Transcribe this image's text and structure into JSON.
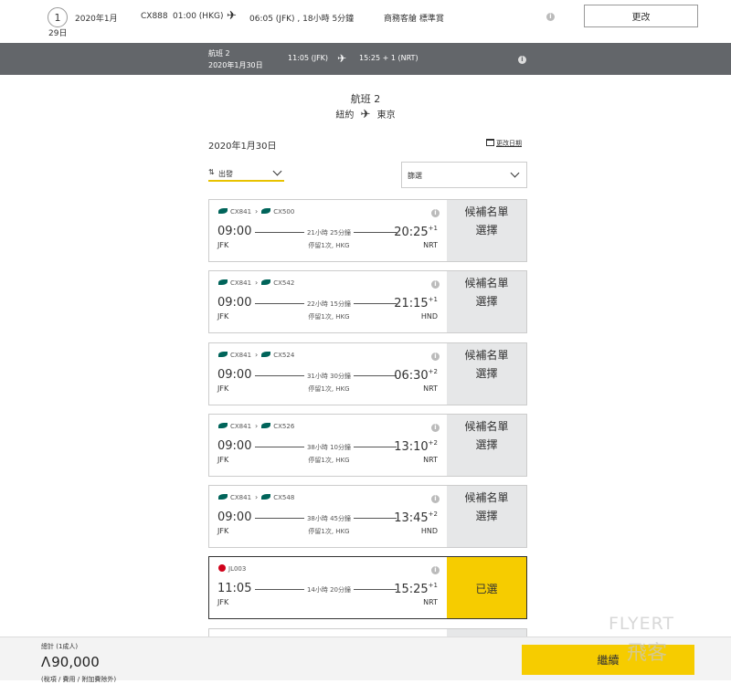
{
  "top_summary": {
    "step": "1",
    "date_line1": "2020年1月",
    "date_line2": "29日",
    "flight": "CX888",
    "depart": "01:00 (HKG)",
    "plane_glyph": "✈",
    "arrive_duration": "06:05 (JFK) , 18小時 5分鐘",
    "cabin": "商務客艙 標準賞",
    "info_icon": "i",
    "change_label": "更改"
  },
  "segment_bar": {
    "title": "航班 2",
    "date": "2020年1月30日",
    "depart_time": "11:05 (JFK)",
    "plane_glyph": "✈",
    "arrive_time": "15:25 + 1 (NRT)",
    "info_icon": "i"
  },
  "heading": {
    "title": "航班 2",
    "from": "紐約",
    "plane_glyph": "✈",
    "to": "東京"
  },
  "date_section": {
    "date": "2020年1月30日",
    "change_date": "更改日期"
  },
  "sort": {
    "icon": "⇅",
    "value": "出發"
  },
  "filter": {
    "value": "篩選"
  },
  "flights": [
    {
      "codes": [
        "CX841",
        "CX500"
      ],
      "dep_time": "09:00",
      "dep_airport": "JFK",
      "duration": "21小時 25分鐘",
      "stops": "停留1次, HKG",
      "arr_time": "20:25",
      "arr_offset": "+1",
      "arr_airport": "NRT",
      "status": "候補名單",
      "action": "選擇",
      "selected": false
    },
    {
      "codes": [
        "CX841",
        "CX542"
      ],
      "dep_time": "09:00",
      "dep_airport": "JFK",
      "duration": "22小時 15分鐘",
      "stops": "停留1次, HKG",
      "arr_time": "21:15",
      "arr_offset": "+1",
      "arr_airport": "HND",
      "status": "候補名單",
      "action": "選擇",
      "selected": false
    },
    {
      "codes": [
        "CX841",
        "CX524"
      ],
      "dep_time": "09:00",
      "dep_airport": "JFK",
      "duration": "31小時 30分鐘",
      "stops": "停留1次, HKG",
      "arr_time": "06:30",
      "arr_offset": "+2",
      "arr_airport": "NRT",
      "status": "候補名單",
      "action": "選擇",
      "selected": false
    },
    {
      "codes": [
        "CX841",
        "CX526"
      ],
      "dep_time": "09:00",
      "dep_airport": "JFK",
      "duration": "38小時 10分鐘",
      "stops": "停留1次, HKG",
      "arr_time": "13:10",
      "arr_offset": "+2",
      "arr_airport": "NRT",
      "status": "候補名單",
      "action": "選擇",
      "selected": false
    },
    {
      "codes": [
        "CX841",
        "CX548"
      ],
      "dep_time": "09:00",
      "dep_airport": "JFK",
      "duration": "38小時 45分鐘",
      "stops": "停留1次, HKG",
      "arr_time": "13:45",
      "arr_offset": "+2",
      "arr_airport": "HND",
      "status": "候補名單",
      "action": "選擇",
      "selected": false
    },
    {
      "codes": [
        "JL003"
      ],
      "dep_time": "11:05",
      "dep_airport": "JFK",
      "duration": "14小時 20分鐘",
      "stops": "",
      "arr_time": "15:25",
      "arr_offset": "+1",
      "arr_airport": "NRT",
      "status": "已選",
      "action": "",
      "selected": true
    }
  ],
  "footer": {
    "total_label": "總計 (1成人)",
    "avios_symbol": "Λ",
    "total_amount": "90,000",
    "fees_note": "(稅項 / 費用 / 附加費除外)",
    "continue_label": "繼續"
  },
  "watermark": {
    "text": "FLYERT",
    "text2": "飛客"
  },
  "colors": {
    "grey_bar": "#63666a",
    "accent_yellow": "#f6cc00",
    "cathay_green": "#00645a",
    "jal_red": "#d0021b",
    "card_side": "#e6e7e8"
  }
}
